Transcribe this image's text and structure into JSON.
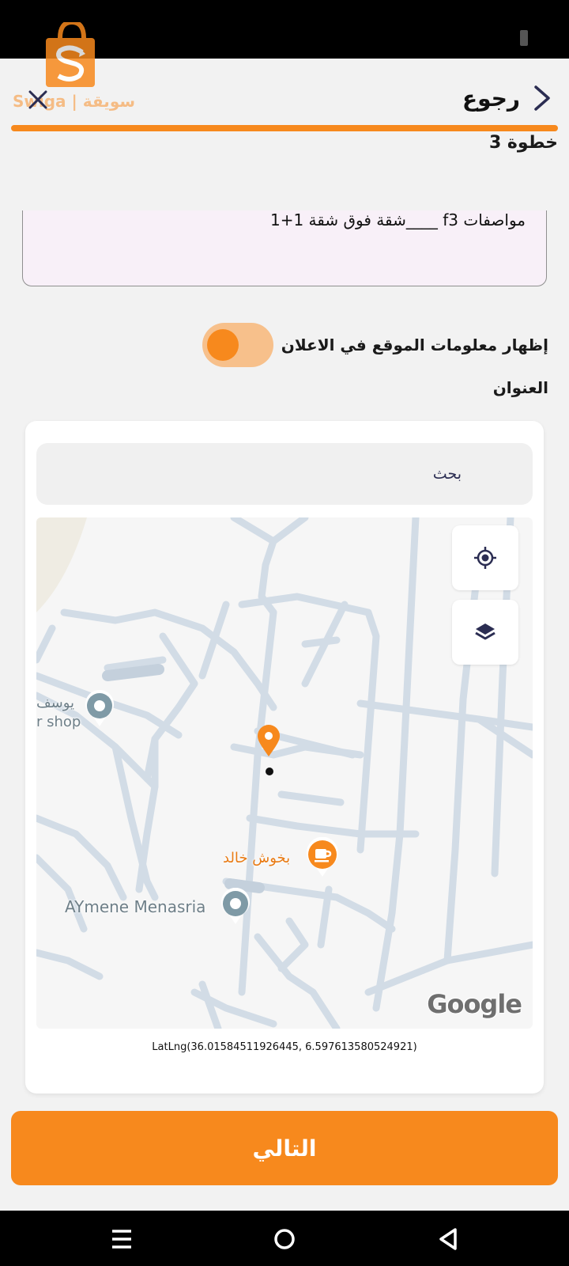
{
  "header": {
    "logo_text": "Swiga | سويقة",
    "back_label": "رجوع",
    "step_label": "خطوة 3"
  },
  "description": {
    "text": "مواصفات f3 ____شقة فوق شقة 1+1"
  },
  "toggle": {
    "label": "إظهار معلومات الموقع في الاعلان",
    "checked": true
  },
  "address": {
    "label": "العنوان",
    "search_placeholder": "بحث"
  },
  "map": {
    "poi_1_line1": "يوسف",
    "poi_1_line2": "r shop",
    "poi_2": "بخوش خالد",
    "poi_3": "AYmene Menasria",
    "attribution": "Google",
    "latlng": "LatLng(36.01584511926445, 6.597613580524921)"
  },
  "footer": {
    "next_label": "التالي"
  },
  "colors": {
    "accent": "#f7891d",
    "accent_light": "#f7c08b"
  }
}
